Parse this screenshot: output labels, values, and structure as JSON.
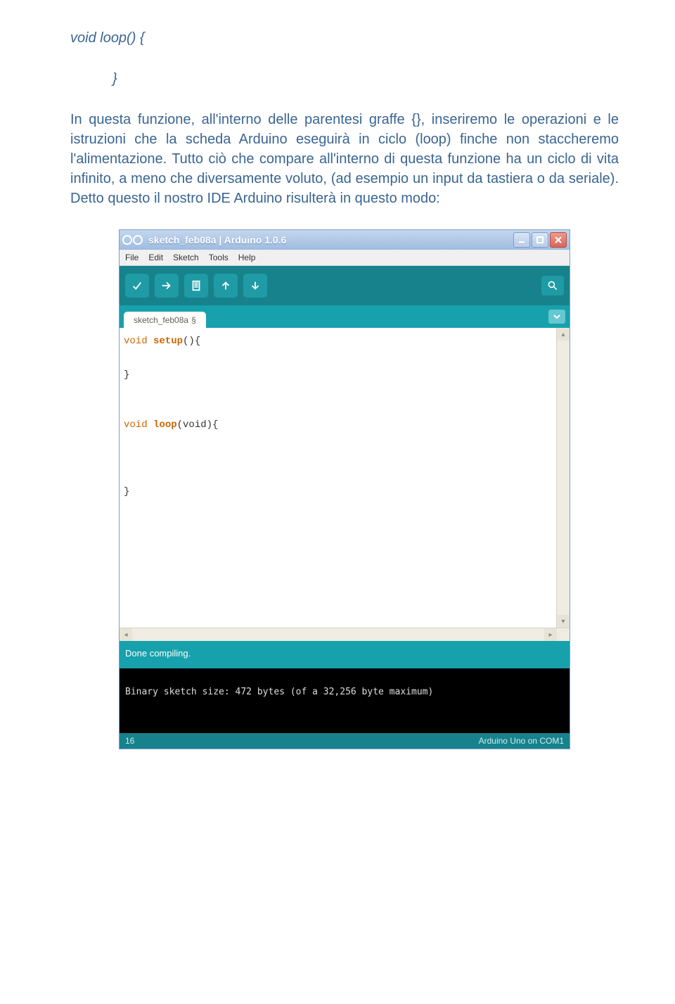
{
  "code_intro": {
    "line1": "void loop() {",
    "line2": "}"
  },
  "paragraph": "In questa funzione, all'interno delle parentesi graffe {}, inseriremo le operazioni e le istruzioni che la scheda Arduino eseguirà in ciclo (loop) finche non staccheremo l'alimentazione. Tutto ciò che compare all'interno di questa funzione ha un ciclo di vita infinito, a meno che diversamente voluto, (ad esempio un input da tastiera o da seriale). Detto questo il nostro IDE Arduino risulterà in questo modo:",
  "ide": {
    "title": "sketch_feb08a | Arduino 1.0.6",
    "menus": [
      "File",
      "Edit",
      "Sketch",
      "Tools",
      "Help"
    ],
    "tab": "sketch_feb08a",
    "tab_suffix": "§",
    "code": {
      "l1_kw": "void",
      "l1_fn": "setup",
      "l1_rest": "(){",
      "l2": "}",
      "l3_kw": "void",
      "l3_fn": "loop",
      "l3_rest": "(void){",
      "l4": "}"
    },
    "status": "Done compiling.",
    "console": "Binary sketch size: 472 bytes (of a 32,256 byte maximum)",
    "bottom_left": "16",
    "bottom_right": "Arduino Uno on COM1"
  },
  "icons": {
    "verify": "verify-icon",
    "upload": "upload-icon",
    "new": "new-file-icon",
    "open": "open-file-icon",
    "save": "save-file-icon",
    "serial": "serial-monitor-icon",
    "min": "minimize-icon",
    "max": "maximize-icon",
    "close": "close-icon",
    "dropdown": "chevron-down-icon"
  }
}
